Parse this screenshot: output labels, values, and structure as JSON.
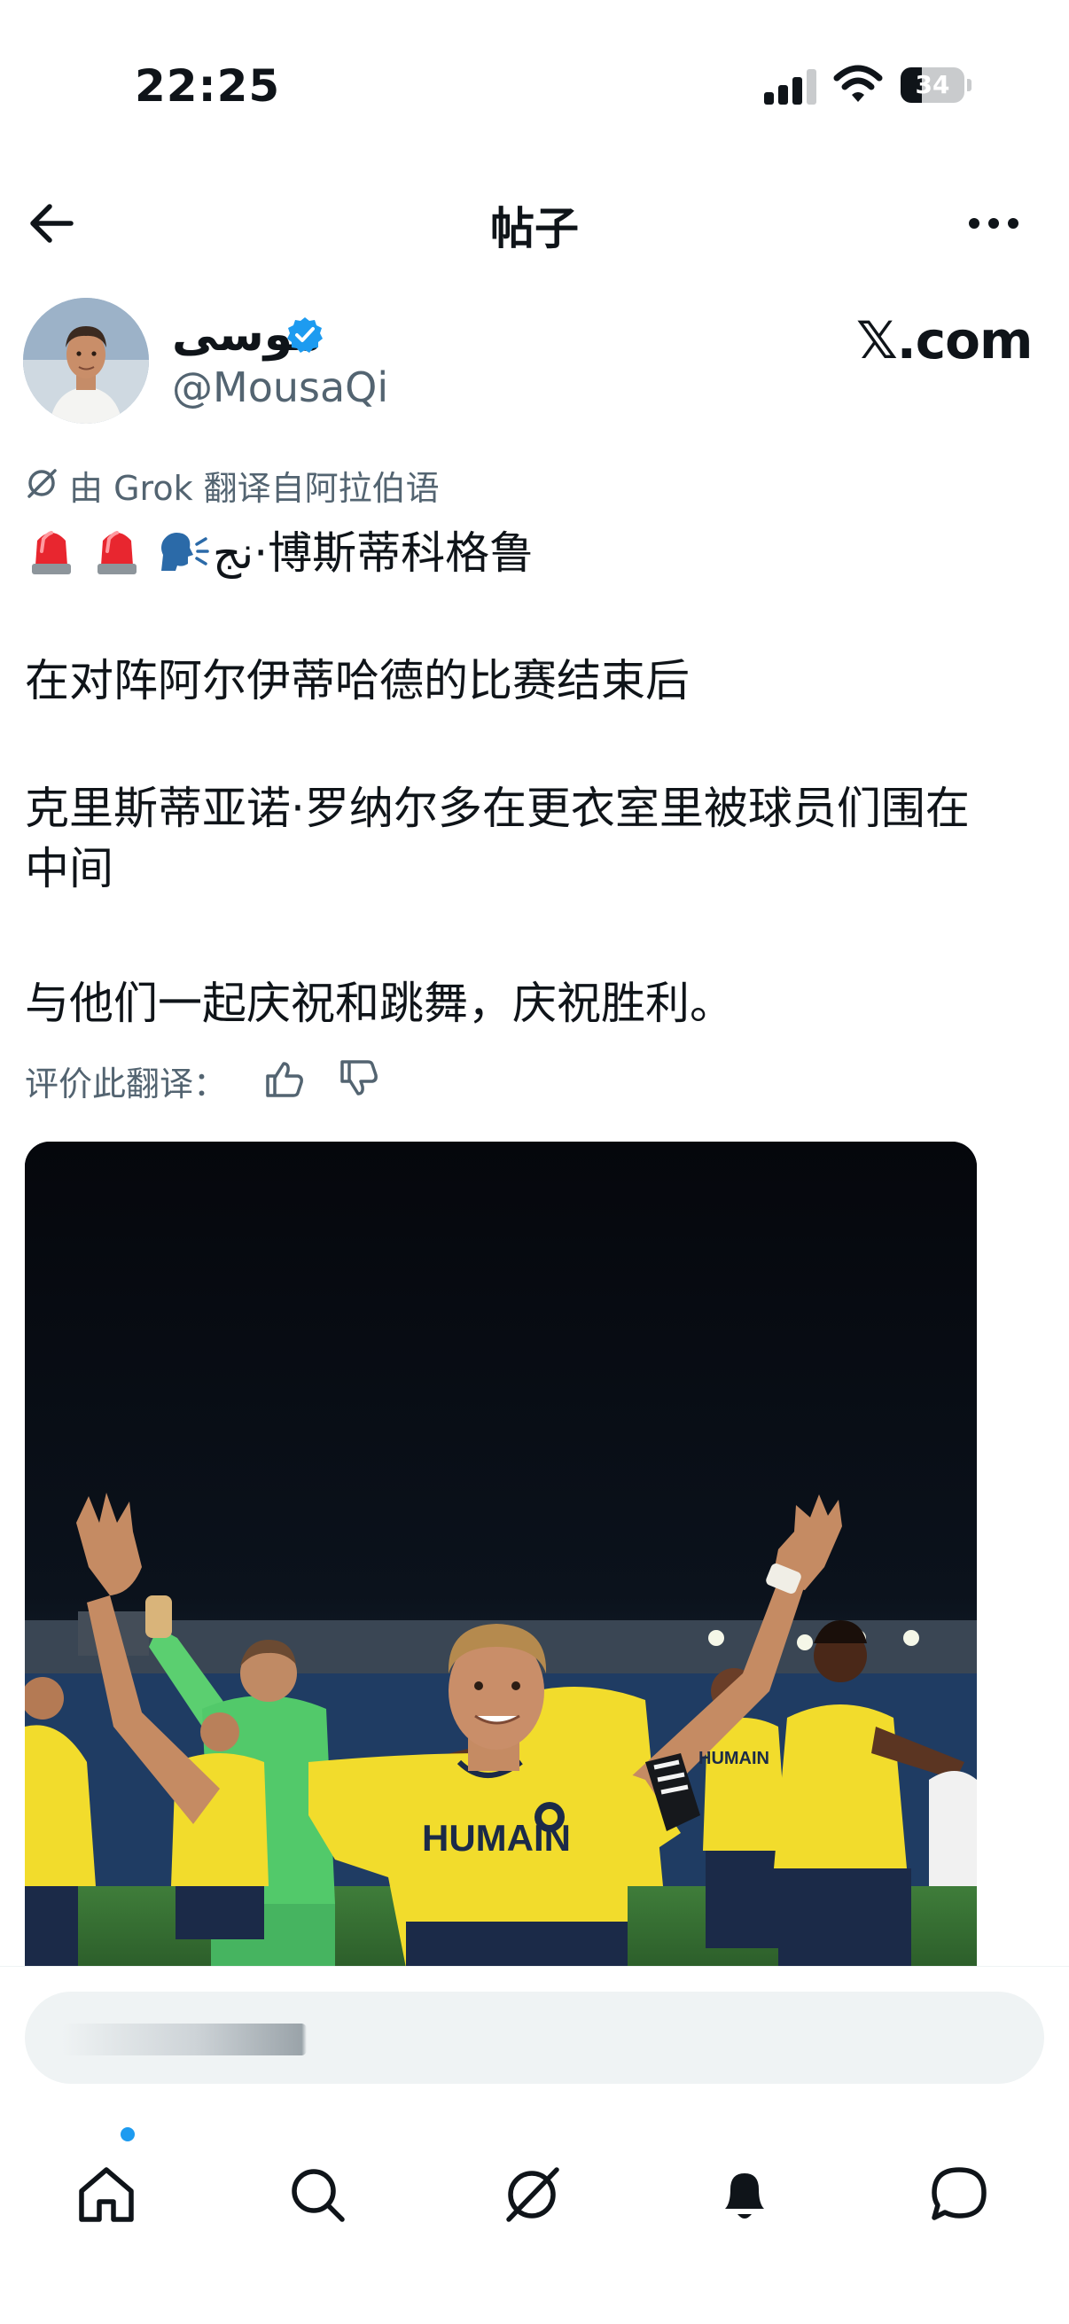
{
  "status_bar": {
    "time": "22:25",
    "battery_percent": 34,
    "battery_label": "34",
    "signal_bars": 3
  },
  "nav": {
    "title": "帖子",
    "back_icon": "arrow-left-icon",
    "more_icon": "more-horizontal-icon"
  },
  "post": {
    "author": {
      "name": "موسى",
      "handle": "@MousaQi",
      "verified": true
    },
    "source_label": "𝕏.com",
    "translation_note": "由 Grok 翻译自阿拉伯语",
    "body_lines": [
      "ﻧﺞ·博斯蒂科格鲁",
      "在对阵阿尔伊蒂哈德的比赛结束后",
      "克里斯蒂亚诺·罗纳尔多在更衣室里被球员们围在",
      "中间",
      "与他们一起庆祝和跳舞，庆祝胜利。"
    ],
    "emojis": [
      "police-light-emoji",
      "police-light-emoji",
      "speaking-head-emoji"
    ],
    "rate_label": "评价此翻译："
  },
  "reply": {
    "placeholder": ""
  },
  "tabs": [
    {
      "name": "home",
      "icon": "home-icon",
      "active": true,
      "badge": true
    },
    {
      "name": "search",
      "icon": "search-icon",
      "active": false
    },
    {
      "name": "grok",
      "icon": "grok-icon",
      "active": false
    },
    {
      "name": "notifications",
      "icon": "bell-icon",
      "active": false
    },
    {
      "name": "messages",
      "icon": "chat-bubble-icon",
      "active": false
    }
  ],
  "colors": {
    "text": "#0f1419",
    "secondary": "#536471",
    "accent": "#1d9bf0",
    "jersey": "#f2dc2c",
    "keeper": "#52c96a"
  }
}
